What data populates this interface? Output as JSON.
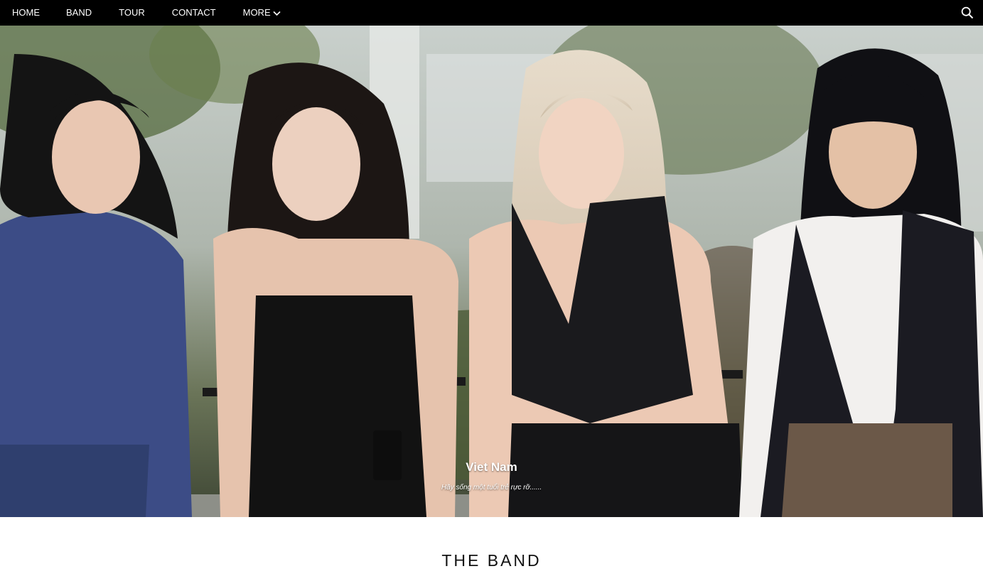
{
  "nav": {
    "items": [
      {
        "label": "HOME"
      },
      {
        "label": "BAND"
      },
      {
        "label": "TOUR"
      },
      {
        "label": "CONTACT"
      },
      {
        "label": "MORE"
      }
    ],
    "more_icon": "chevron-down-icon",
    "search_icon": "search-icon",
    "background": "#000000",
    "text_color": "#ffffff"
  },
  "hero": {
    "title": "Viet Nam",
    "subtitle": "Hãy sống một tuổi trẻ rực rỡ......"
  },
  "section": {
    "title": "THE BAND"
  }
}
